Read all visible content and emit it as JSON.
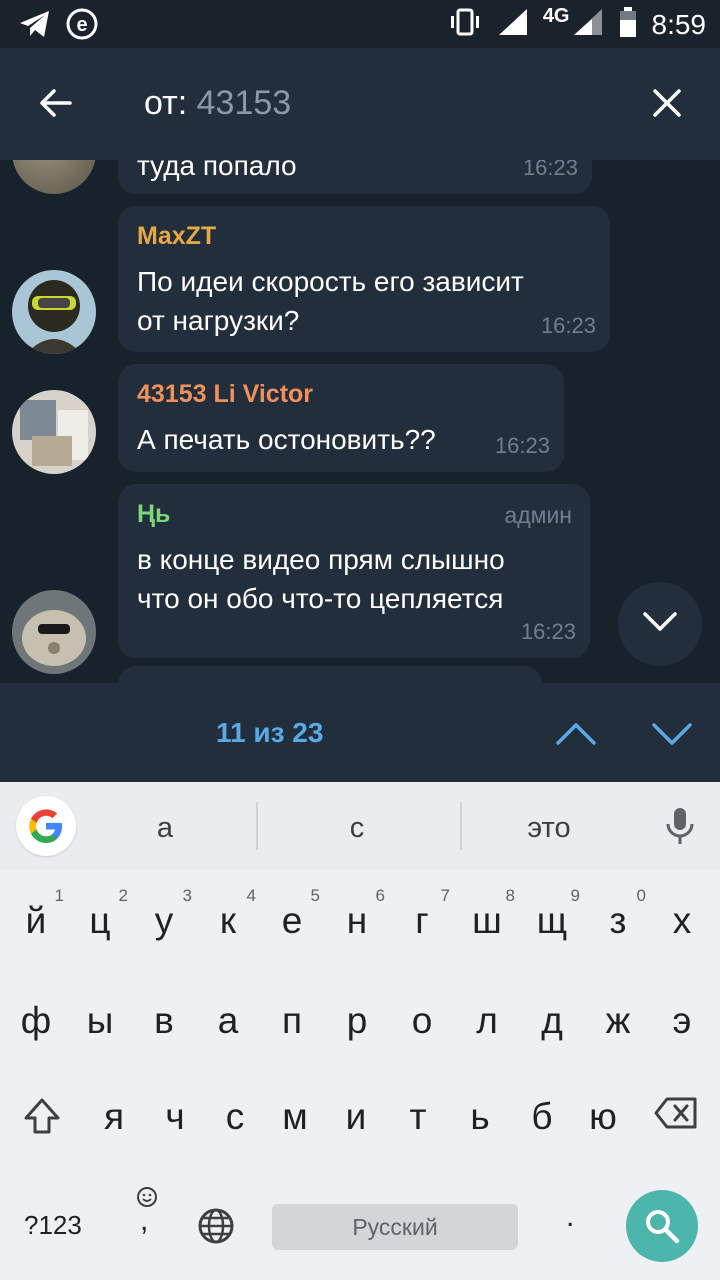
{
  "status_bar": {
    "network": "4G",
    "time": "8:59",
    "icons": [
      "telegram-icon",
      "e-icon",
      "vibrate-icon",
      "signal-icon",
      "battery-icon"
    ]
  },
  "header": {
    "search_prefix": "от:",
    "search_query": "43153",
    "back_icon": "arrow-left-icon",
    "close_icon": "close-icon"
  },
  "messages": [
    {
      "text": "туда попало",
      "time": "16:23",
      "partial": true
    },
    {
      "sender": "MaxZT",
      "sender_color": "#e5a844",
      "text_lines": [
        "По идеи скорость его зависит",
        "от нагрузки?"
      ],
      "time": "16:23"
    },
    {
      "sender": "43153 Li Victor",
      "sender_color": "#f0915a",
      "text_lines": [
        "А печать остоновить??"
      ],
      "time": "16:23"
    },
    {
      "sender": "Ңь",
      "sender_color": "#7dd67a",
      "role": "админ",
      "text_lines": [
        "в конце видео прям слышно",
        "что он обо что-то цепляется"
      ],
      "time": "16:23"
    }
  ],
  "search_nav": {
    "counter": "11 из 23",
    "accent": "#59a9e6"
  },
  "keyboard": {
    "suggestions": [
      "а",
      "с",
      "это"
    ],
    "row1": [
      {
        "k": "й",
        "h": "1"
      },
      {
        "k": "ц",
        "h": "2"
      },
      {
        "k": "у",
        "h": "3"
      },
      {
        "k": "к",
        "h": "4"
      },
      {
        "k": "е",
        "h": "5"
      },
      {
        "k": "н",
        "h": "6"
      },
      {
        "k": "г",
        "h": "7"
      },
      {
        "k": "ш",
        "h": "8"
      },
      {
        "k": "щ",
        "h": "9"
      },
      {
        "k": "з",
        "h": "0"
      },
      {
        "k": "х",
        "h": ""
      }
    ],
    "row2": [
      "ф",
      "ы",
      "в",
      "а",
      "п",
      "р",
      "о",
      "л",
      "д",
      "ж",
      "э"
    ],
    "row3": [
      "я",
      "ч",
      "с",
      "м",
      "и",
      "т",
      "ь",
      "б",
      "ю"
    ],
    "symbols_key": "?123",
    "space_label": "Русский",
    "period": ".",
    "comma": ","
  }
}
